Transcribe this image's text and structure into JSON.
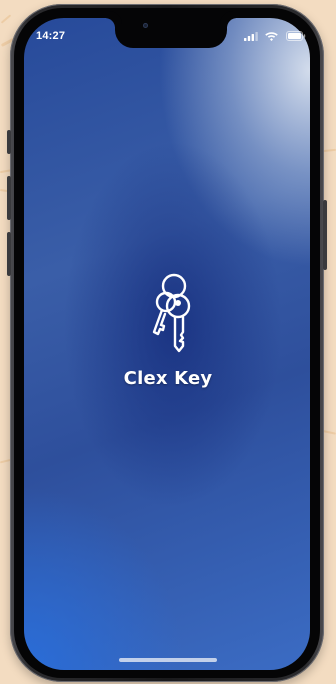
{
  "status_bar": {
    "time": "14:27",
    "signal_icon": "cellular-signal-icon",
    "wifi_icon": "wifi-icon",
    "battery_icon": "battery-icon"
  },
  "splash": {
    "logo_icon": "keys-icon",
    "app_name": "Clex Key"
  },
  "colors": {
    "screen_gradient_start": "#274a9a",
    "screen_gradient_end": "#3b6cc4",
    "text": "#ffffff",
    "background": "#f3dcc1"
  }
}
